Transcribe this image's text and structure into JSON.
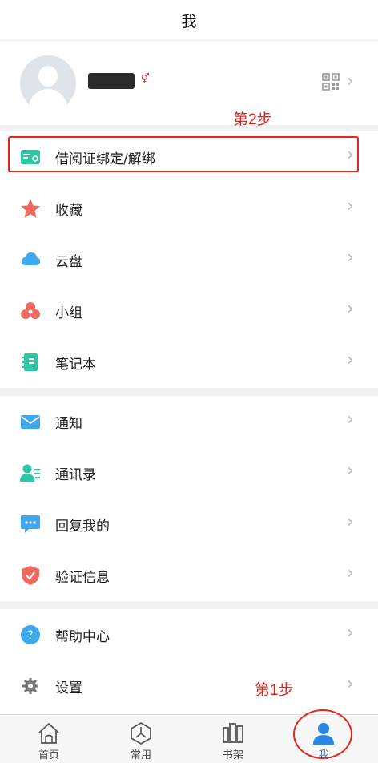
{
  "header": {
    "title": "我"
  },
  "profile": {
    "username_masked": "",
    "gender_icon": "gender-icon",
    "qr_icon": "qr-code-icon"
  },
  "annotations": {
    "step1": "第1步",
    "step2": "第2步"
  },
  "menu": {
    "group1": [
      {
        "label": "借阅证绑定/解绑",
        "icon": "library-card-icon",
        "color": "#2fc6a4"
      },
      {
        "label": "收藏",
        "icon": "star-icon",
        "color": "#f0695f"
      },
      {
        "label": "云盘",
        "icon": "cloud-icon",
        "color": "#3fa9ef"
      },
      {
        "label": "小组",
        "icon": "group-icon",
        "color": "#f0695f"
      },
      {
        "label": "笔记本",
        "icon": "notebook-icon",
        "color": "#2fc6a4"
      }
    ],
    "group2": [
      {
        "label": "通知",
        "icon": "mail-icon",
        "color": "#3fa9ef"
      },
      {
        "label": "通讯录",
        "icon": "contacts-icon",
        "color": "#2fc6a4"
      },
      {
        "label": "回复我的",
        "icon": "chat-icon",
        "color": "#3fa9ef"
      },
      {
        "label": "验证信息",
        "icon": "shield-icon",
        "color": "#f0695f"
      }
    ],
    "group3": [
      {
        "label": "帮助中心",
        "icon": "help-icon",
        "color": "#3fa9ef"
      },
      {
        "label": "设置",
        "icon": "gear-icon",
        "color": "#777777"
      }
    ]
  },
  "tabbar": {
    "tabs": [
      {
        "label": "首页",
        "icon": "home-icon"
      },
      {
        "label": "常用",
        "icon": "compass-icon"
      },
      {
        "label": "书架",
        "icon": "bookshelf-icon"
      },
      {
        "label": "我",
        "icon": "user-icon",
        "active": true
      }
    ],
    "active_color": "#2a85e8"
  }
}
